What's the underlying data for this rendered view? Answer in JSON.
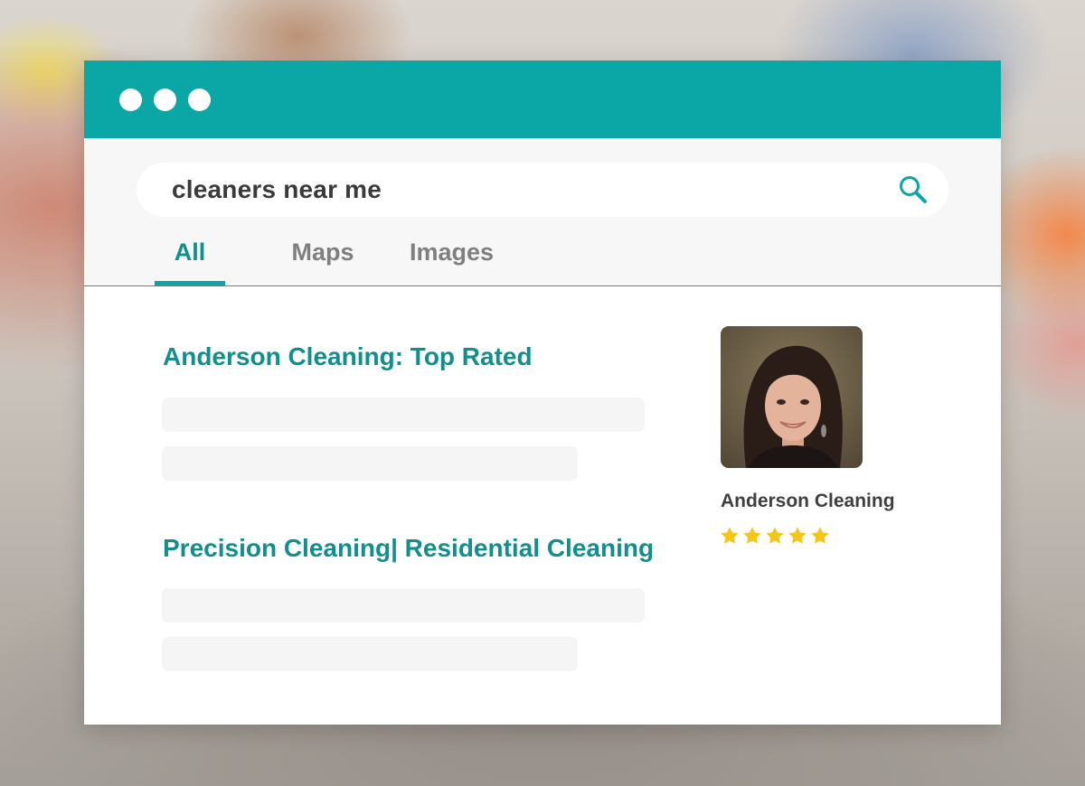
{
  "search": {
    "query": "cleaners near me"
  },
  "tabs": [
    {
      "label": "All",
      "active": true
    },
    {
      "label": "Maps",
      "active": false
    },
    {
      "label": "Images",
      "active": false
    }
  ],
  "results": [
    {
      "title": "Anderson Cleaning: Top Rated"
    },
    {
      "title": "Precision Cleaning| Residential Cleaning"
    }
  ],
  "business_card": {
    "name": "Anderson Cleaning",
    "rating": 5,
    "rating_max": 5
  },
  "colors": {
    "accent": "#0aa7a6",
    "link": "#0f8f8e",
    "star": "#f5c518"
  },
  "icons": [
    "search-icon",
    "star-icon"
  ]
}
